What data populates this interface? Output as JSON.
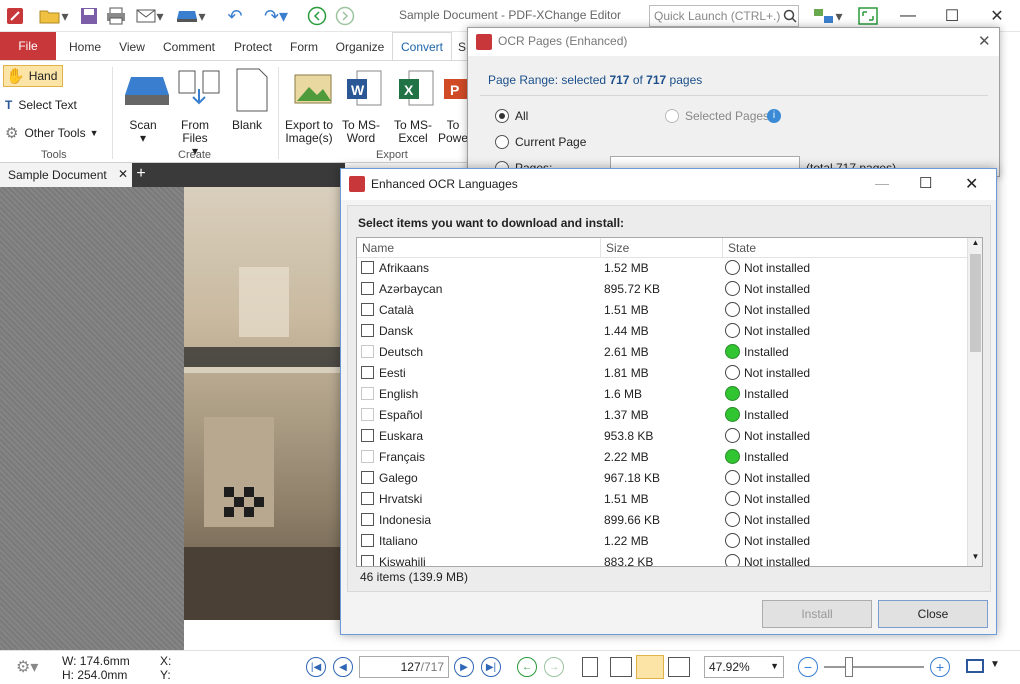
{
  "app": {
    "title": "Sample Document - PDF-XChange Editor",
    "quick_launch_placeholder": "Quick Launch (CTRL+.)"
  },
  "ribbon": {
    "tabs": [
      "File",
      "Home",
      "View",
      "Comment",
      "Protect",
      "Form",
      "Organize",
      "Convert",
      "S"
    ],
    "active_tab": "Convert",
    "tools": {
      "hand": "Hand",
      "select_text": "Select Text",
      "other_tools": "Other Tools",
      "group": "Tools"
    },
    "create": {
      "scan": "Scan",
      "from_files": "From Files",
      "blank": "Blank",
      "group": "Create"
    },
    "export": {
      "export_images": "Export to Image(s)",
      "to_word": "To MS-Word",
      "to_excel": "To MS-Excel",
      "to_ppt": "To Powe",
      "group": "Export"
    }
  },
  "document_tab": {
    "label": "Sample Document"
  },
  "status": {
    "width": "W: 174.6mm",
    "height": "H: 254.0mm",
    "x": "X:",
    "y": "Y:",
    "page_current": "127",
    "page_total": "/717",
    "zoom": "47.92%"
  },
  "ocr_dialog": {
    "title": "OCR Pages (Enhanced)",
    "range_prefix": "Page Range: selected",
    "range_selected": "717",
    "range_of": "of",
    "range_total": "717",
    "range_suffix": "pages",
    "all_label": "All",
    "selected_pages_label": "Selected Pages",
    "current_page_label": "Current Page",
    "pages_label": "Pages:",
    "pages_total": "(total 717 pages)"
  },
  "lang_dialog": {
    "title": "Enhanced OCR Languages",
    "prompt": "Select items you want to download and install:",
    "columns": {
      "name": "Name",
      "size": "Size",
      "state": "State"
    },
    "rows": [
      {
        "name": "Afrikaans",
        "size": "1.52 MB",
        "state": "Not installed",
        "installed": false
      },
      {
        "name": "Azərbaycan",
        "size": "895.72 KB",
        "state": "Not installed",
        "installed": false
      },
      {
        "name": "Català",
        "size": "1.51 MB",
        "state": "Not installed",
        "installed": false
      },
      {
        "name": "Dansk",
        "size": "1.44 MB",
        "state": "Not installed",
        "installed": false
      },
      {
        "name": "Deutsch",
        "size": "2.61 MB",
        "state": "Installed",
        "installed": true
      },
      {
        "name": "Eesti",
        "size": "1.81 MB",
        "state": "Not installed",
        "installed": false
      },
      {
        "name": "English",
        "size": "1.6 MB",
        "state": "Installed",
        "installed": true
      },
      {
        "name": "Español",
        "size": "1.37 MB",
        "state": "Installed",
        "installed": true
      },
      {
        "name": "Euskara",
        "size": "953.8 KB",
        "state": "Not installed",
        "installed": false
      },
      {
        "name": "Français",
        "size": "2.22 MB",
        "state": "Installed",
        "installed": true
      },
      {
        "name": "Galego",
        "size": "967.18 KB",
        "state": "Not installed",
        "installed": false
      },
      {
        "name": "Hrvatski",
        "size": "1.51 MB",
        "state": "Not installed",
        "installed": false
      },
      {
        "name": "Indonesia",
        "size": "899.66 KB",
        "state": "Not installed",
        "installed": false
      },
      {
        "name": "Italiano",
        "size": "1.22 MB",
        "state": "Not installed",
        "installed": false
      },
      {
        "name": "Kiswahili",
        "size": "883.2 KB",
        "state": "Not installed",
        "installed": false
      }
    ],
    "count": "46 items (139.9 MB)",
    "install_button": "Install",
    "close_button": "Close"
  },
  "colors": {
    "accent": "#2b579a",
    "file_tab": "#c8373a",
    "installed": "#31c531"
  }
}
